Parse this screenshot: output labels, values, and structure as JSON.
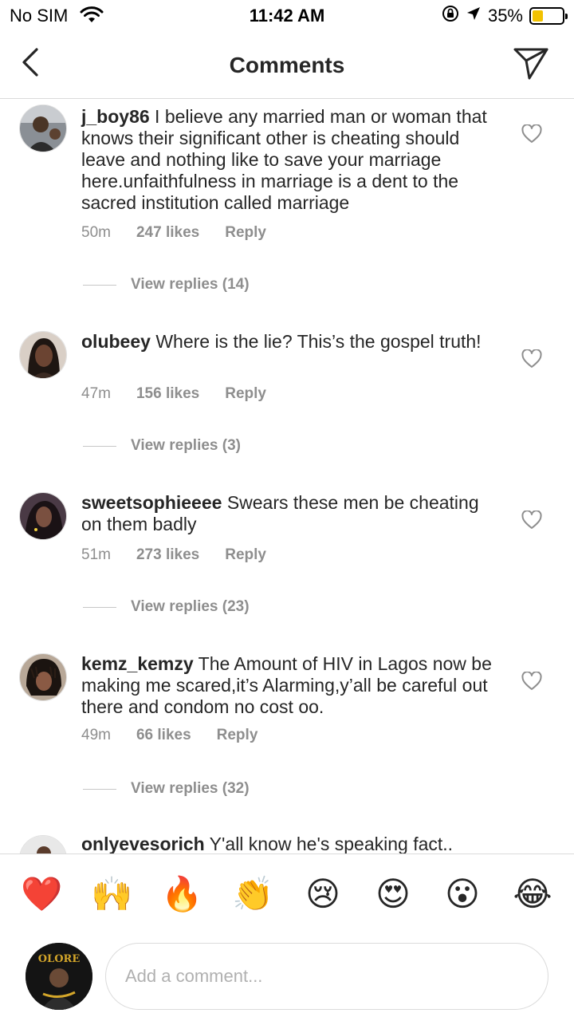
{
  "status_bar": {
    "carrier": "No SIM",
    "time": "11:42 AM",
    "battery": "35%",
    "battery_level": 0.35,
    "battery_color": "#f2c200"
  },
  "header": {
    "title": "Comments",
    "back_icon": "chevron-left-icon",
    "send_icon": "paper-plane-icon"
  },
  "comments": [
    {
      "username": "j_boy86",
      "text": "I believe any married man or woman that knows their significant other is cheating should leave and nothing like to save your marriage here.unfaithfulness in marriage is a dent to the sacred institution called marriage",
      "time": "50m",
      "likes": "247 likes",
      "reply": "Reply",
      "view_replies": "View replies (14)"
    },
    {
      "username": "olubeey",
      "text": "Where is the lie? This’s the gospel truth!",
      "time": "47m",
      "likes": "156 likes",
      "reply": "Reply",
      "view_replies": "View replies (3)"
    },
    {
      "username": "sweetsophieeee",
      "text": "Swears these men be cheating on them badly",
      "time": "51m",
      "likes": "273 likes",
      "reply": "Reply",
      "view_replies": "View replies (23)"
    },
    {
      "username": "kemz_kemzy",
      "text": "The Amount of HIV in Lagos now be making me scared,it’s Alarming,y’all be careful out there and condom no cost oo.",
      "time": "49m",
      "likes": "66 likes",
      "reply": "Reply",
      "view_replies": "View replies (32)"
    },
    {
      "username": "onlyevesorich",
      "text": "Y'all know he's speaking fact.."
    }
  ],
  "emoji_bar": [
    "❤️",
    "🙌",
    "🔥",
    "👏",
    "😢",
    "😍",
    "😮",
    "😂"
  ],
  "composer": {
    "placeholder": "Add a comment...",
    "avatar_text": "OLORE"
  }
}
